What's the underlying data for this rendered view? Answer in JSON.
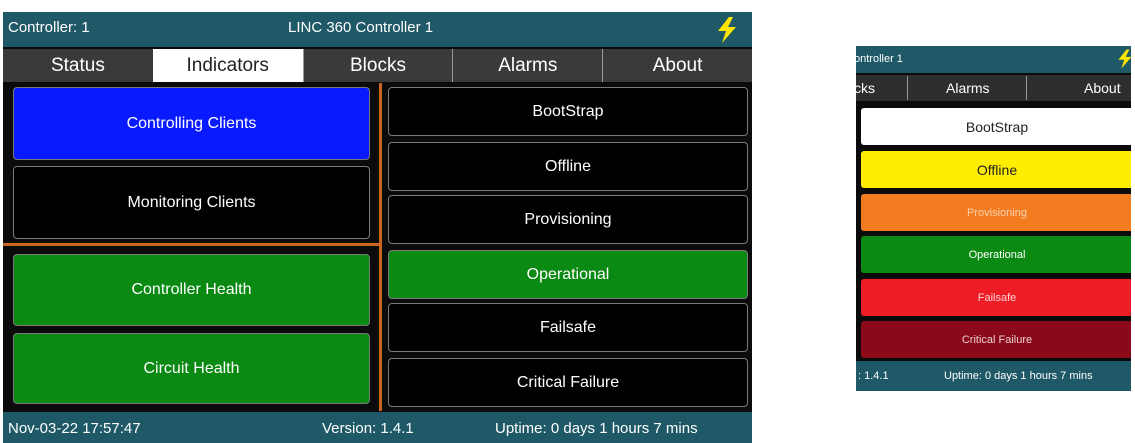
{
  "main": {
    "title": {
      "controller": "Controller: 1",
      "name": "LINC 360 Controller 1"
    },
    "tabs": [
      "Status",
      "Indicators",
      "Blocks",
      "Alarms",
      "About"
    ],
    "active_tab": "Indicators",
    "clients": [
      {
        "label": "Controlling Clients",
        "color": "#0a1aff"
      },
      {
        "label": "Monitoring Clients",
        "color": "#000000"
      }
    ],
    "health": [
      {
        "label": "Controller Health",
        "color": "#0a8a12"
      },
      {
        "label": "Circuit Health",
        "color": "#0a8a12"
      }
    ],
    "states": [
      {
        "label": "BootStrap",
        "color": "#000000"
      },
      {
        "label": "Offline",
        "color": "#000000"
      },
      {
        "label": "Provisioning",
        "color": "#000000"
      },
      {
        "label": "Operational",
        "color": "#0a8a12"
      },
      {
        "label": "Failsafe",
        "color": "#000000"
      },
      {
        "label": "Critical Failure",
        "color": "#000000"
      }
    ],
    "status": {
      "datetime": "Nov-03-22 17:57:47",
      "version": "Version: 1.4.1",
      "uptime": "Uptime: 0 days 1 hours 7 mins"
    }
  },
  "phone": {
    "title": "ontroller 1",
    "tabs": [
      "cks",
      "Alarms",
      "About"
    ],
    "states": [
      {
        "label": "BootStrap",
        "bg": "#ffffff",
        "fg": "#222222"
      },
      {
        "label": "Offline",
        "bg": "#ffee00",
        "fg": "#222222"
      },
      {
        "label": "Provisioning",
        "bg": "#f47c20",
        "fg": "#f9d2b0"
      },
      {
        "label": "Operational",
        "bg": "#0a8a12",
        "fg": "#ffffff"
      },
      {
        "label": "Failsafe",
        "bg": "#ee1c25",
        "fg": "#fbd0d0"
      },
      {
        "label": "Critical Failure",
        "bg": "#8b0a1a",
        "fg": "#ead0d0"
      }
    ],
    "status": {
      "version": ": 1.4.1",
      "uptime": "Uptime: 0 days 1 hours 7 mins"
    }
  },
  "icons": {
    "power": "lightning-bolt-icon",
    "bolt_color": "#ffe600"
  }
}
